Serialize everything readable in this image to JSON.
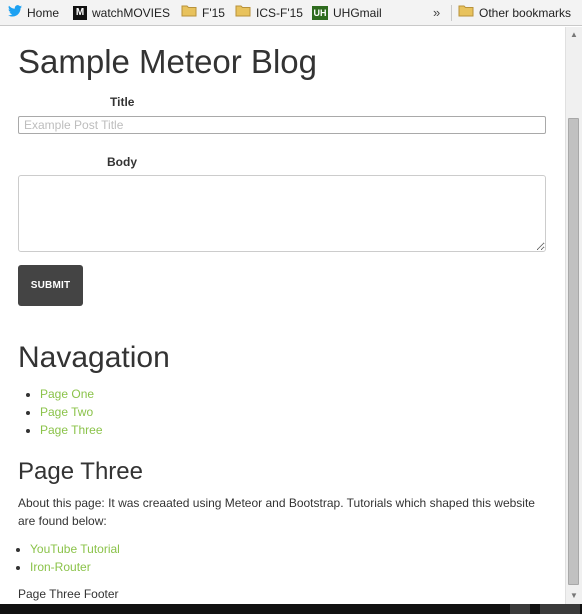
{
  "bookmarks_bar": {
    "items": [
      {
        "label": "Home",
        "icon": "twitter-bird-icon"
      },
      {
        "label": "watchMOVIES",
        "icon": "m-logo-icon"
      },
      {
        "label": "F'15",
        "icon": "folder-icon"
      },
      {
        "label": "ICS-F'15",
        "icon": "folder-icon"
      },
      {
        "label": "UHGmail",
        "icon": "uh-logo-icon"
      }
    ],
    "overflow_glyph": "»",
    "other_bookmarks": {
      "label": "Other bookmarks",
      "icon": "folder-icon"
    },
    "m_logo_text": "M",
    "uh_logo_text": "UH"
  },
  "page": {
    "title": "Sample Meteor Blog",
    "form": {
      "title_label": "Title",
      "title_placeholder": "Example Post Title",
      "title_value": "",
      "body_label": "Body",
      "body_value": "",
      "submit_label": "SUBMIT"
    },
    "nav": {
      "heading": "Navagation",
      "links": [
        "Page One",
        "Page Two",
        "Page Three"
      ]
    },
    "section": {
      "heading": "Page Three",
      "about": "About this page: It was creaated using Meteor and Bootstrap. Tutorials which shaped this website are found below:",
      "tutorials": [
        "YouTube Tutorial",
        "Iron-Router"
      ],
      "footer": "Page Three Footer"
    }
  },
  "colors": {
    "link": "#8bc34a",
    "button_bg": "#444444",
    "heading": "#333333",
    "twitter_blue": "#1da1f2",
    "folder_yellow": "#e8c25c",
    "uh_green": "#2e6b1e"
  }
}
